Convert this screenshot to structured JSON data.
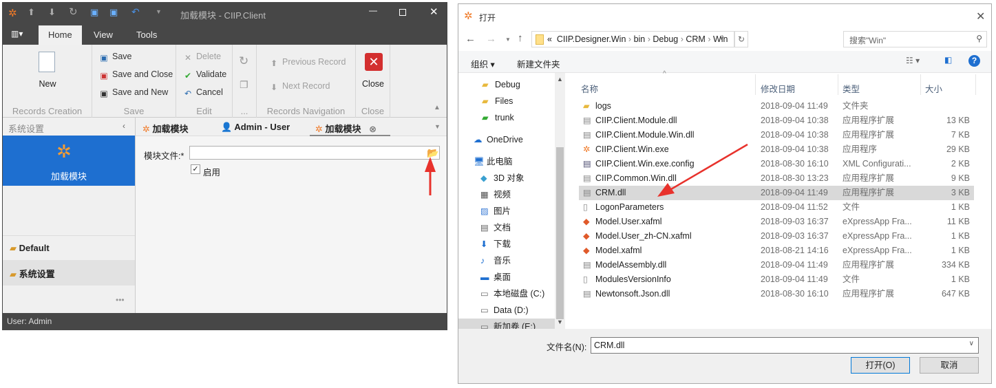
{
  "app": {
    "title": "加载模块 - CIIP.Client",
    "menu_tabs": [
      "Home",
      "View",
      "Tools"
    ],
    "ribbon": {
      "new": "New",
      "records_creation": "Records Creation",
      "save": "Save",
      "save_and_close": "Save and Close",
      "save_and_new": "Save and New",
      "save_group": "Save",
      "delete": "Delete",
      "validate": "Validate",
      "cancel": "Cancel",
      "edit_group": "Edit",
      "more_group": "...",
      "previous_record": "Previous Record",
      "next_record": "Next Record",
      "nav_group": "Records Navigation",
      "close": "Close",
      "close_group": "Close"
    },
    "nav": {
      "header": "系统设置",
      "selected_item": "加载模块",
      "groups": [
        "Default",
        "系统设置"
      ],
      "more": "•••"
    },
    "doc_tabs": [
      "加载模块",
      "Admin - User",
      "加载模块"
    ],
    "form": {
      "module_file_label": "模块文件:*",
      "module_file_value": "",
      "enabled_label": "启用",
      "enabled": true
    },
    "status": "User: Admin"
  },
  "dialog": {
    "title": "打开",
    "breadcrumb": [
      "«",
      "CIIP.Designer.Win",
      "bin",
      "Debug",
      "CRM",
      "Win"
    ],
    "search_placeholder": "搜索\"Win\"",
    "organize": "组织 ▾",
    "new_folder": "新建文件夹",
    "nav_items": [
      {
        "label": "Debug",
        "icon": "folder"
      },
      {
        "label": "Files",
        "icon": "folder"
      },
      {
        "label": "trunk",
        "icon": "folder-check"
      },
      {
        "label": "OneDrive",
        "icon": "cloud"
      },
      {
        "label": "此电脑",
        "icon": "computer"
      },
      {
        "label": "3D 对象",
        "icon": "cube"
      },
      {
        "label": "视频",
        "icon": "video"
      },
      {
        "label": "图片",
        "icon": "picture"
      },
      {
        "label": "文档",
        "icon": "document"
      },
      {
        "label": "下载",
        "icon": "download"
      },
      {
        "label": "音乐",
        "icon": "music"
      },
      {
        "label": "桌面",
        "icon": "desktop"
      },
      {
        "label": "本地磁盘 (C:)",
        "icon": "drive"
      },
      {
        "label": "Data (D:)",
        "icon": "drive"
      },
      {
        "label": "新加卷 (E:)",
        "icon": "drive"
      }
    ],
    "columns": [
      "名称",
      "修改日期",
      "类型",
      "大小"
    ],
    "files": [
      {
        "name": "logs",
        "date": "2018-09-04 11:49",
        "type": "文件夹",
        "size": "",
        "icon": "folder"
      },
      {
        "name": "CIIP.Client.Module.dll",
        "date": "2018-09-04 10:38",
        "type": "应用程序扩展",
        "size": "13 KB",
        "icon": "dll"
      },
      {
        "name": "CIIP.Client.Module.Win.dll",
        "date": "2018-09-04 10:38",
        "type": "应用程序扩展",
        "size": "7 KB",
        "icon": "dll"
      },
      {
        "name": "CIIP.Client.Win.exe",
        "date": "2018-09-04 10:38",
        "type": "应用程序",
        "size": "29 KB",
        "icon": "exe"
      },
      {
        "name": "CIIP.Client.Win.exe.config",
        "date": "2018-08-30 16:10",
        "type": "XML Configurati...",
        "size": "2 KB",
        "icon": "config"
      },
      {
        "name": "CIIP.Common.Win.dll",
        "date": "2018-08-30 13:23",
        "type": "应用程序扩展",
        "size": "9 KB",
        "icon": "dll"
      },
      {
        "name": "CRM.dll",
        "date": "2018-09-04 11:49",
        "type": "应用程序扩展",
        "size": "3 KB",
        "icon": "dll",
        "selected": true
      },
      {
        "name": "LogonParameters",
        "date": "2018-09-04 11:52",
        "type": "文件",
        "size": "1 KB",
        "icon": "file"
      },
      {
        "name": "Model.User.xafml",
        "date": "2018-09-03 16:37",
        "type": "eXpressApp Fra...",
        "size": "11 KB",
        "icon": "xafml"
      },
      {
        "name": "Model.User_zh-CN.xafml",
        "date": "2018-09-03 16:37",
        "type": "eXpressApp Fra...",
        "size": "1 KB",
        "icon": "xafml"
      },
      {
        "name": "Model.xafml",
        "date": "2018-08-21 14:16",
        "type": "eXpressApp Fra...",
        "size": "1 KB",
        "icon": "xafml"
      },
      {
        "name": "ModelAssembly.dll",
        "date": "2018-09-04 11:49",
        "type": "应用程序扩展",
        "size": "334 KB",
        "icon": "dll"
      },
      {
        "name": "ModulesVersionInfo",
        "date": "2018-09-04 11:49",
        "type": "文件",
        "size": "1 KB",
        "icon": "file"
      },
      {
        "name": "Newtonsoft.Json.dll",
        "date": "2018-08-30 16:10",
        "type": "应用程序扩展",
        "size": "647 KB",
        "icon": "dll"
      }
    ],
    "filename_label": "文件名(N):",
    "filename_value": "CRM.dll",
    "open": "打开(O)",
    "cancel": "取消"
  },
  "colors": {
    "accent": "#1e6fd0",
    "annotation_arrow": "#e8322c",
    "dark_chrome": "#474747"
  }
}
